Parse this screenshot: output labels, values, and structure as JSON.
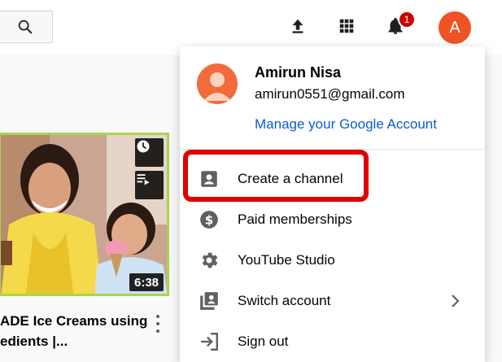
{
  "topbar": {
    "icons": [
      "search-icon",
      "upload-icon",
      "apps-grid-icon",
      "notifications-bell-icon"
    ],
    "notification_count": "1",
    "avatar_letter": "A"
  },
  "video": {
    "duration": "6:38",
    "title_line1": "ADE Ice Creams using",
    "title_line2": "edients |...",
    "meta": "..."
  },
  "account_menu": {
    "name": "Amirun Nisa",
    "email": "amirun0551@gmail.com",
    "manage_link": "Manage your Google Account",
    "items": [
      {
        "label": "Create a channel",
        "icon": "create-channel-icon"
      },
      {
        "label": "Paid memberships",
        "icon": "dollar-icon"
      },
      {
        "label": "YouTube Studio",
        "icon": "gear-icon"
      },
      {
        "label": "Switch account",
        "icon": "switch-account-icon"
      },
      {
        "label": "Sign out",
        "icon": "sign-out-icon"
      }
    ]
  },
  "colors": {
    "avatar": "#ef5323",
    "link": "#065fd4",
    "highlight": "#e00000",
    "badge": "#cc0000"
  }
}
